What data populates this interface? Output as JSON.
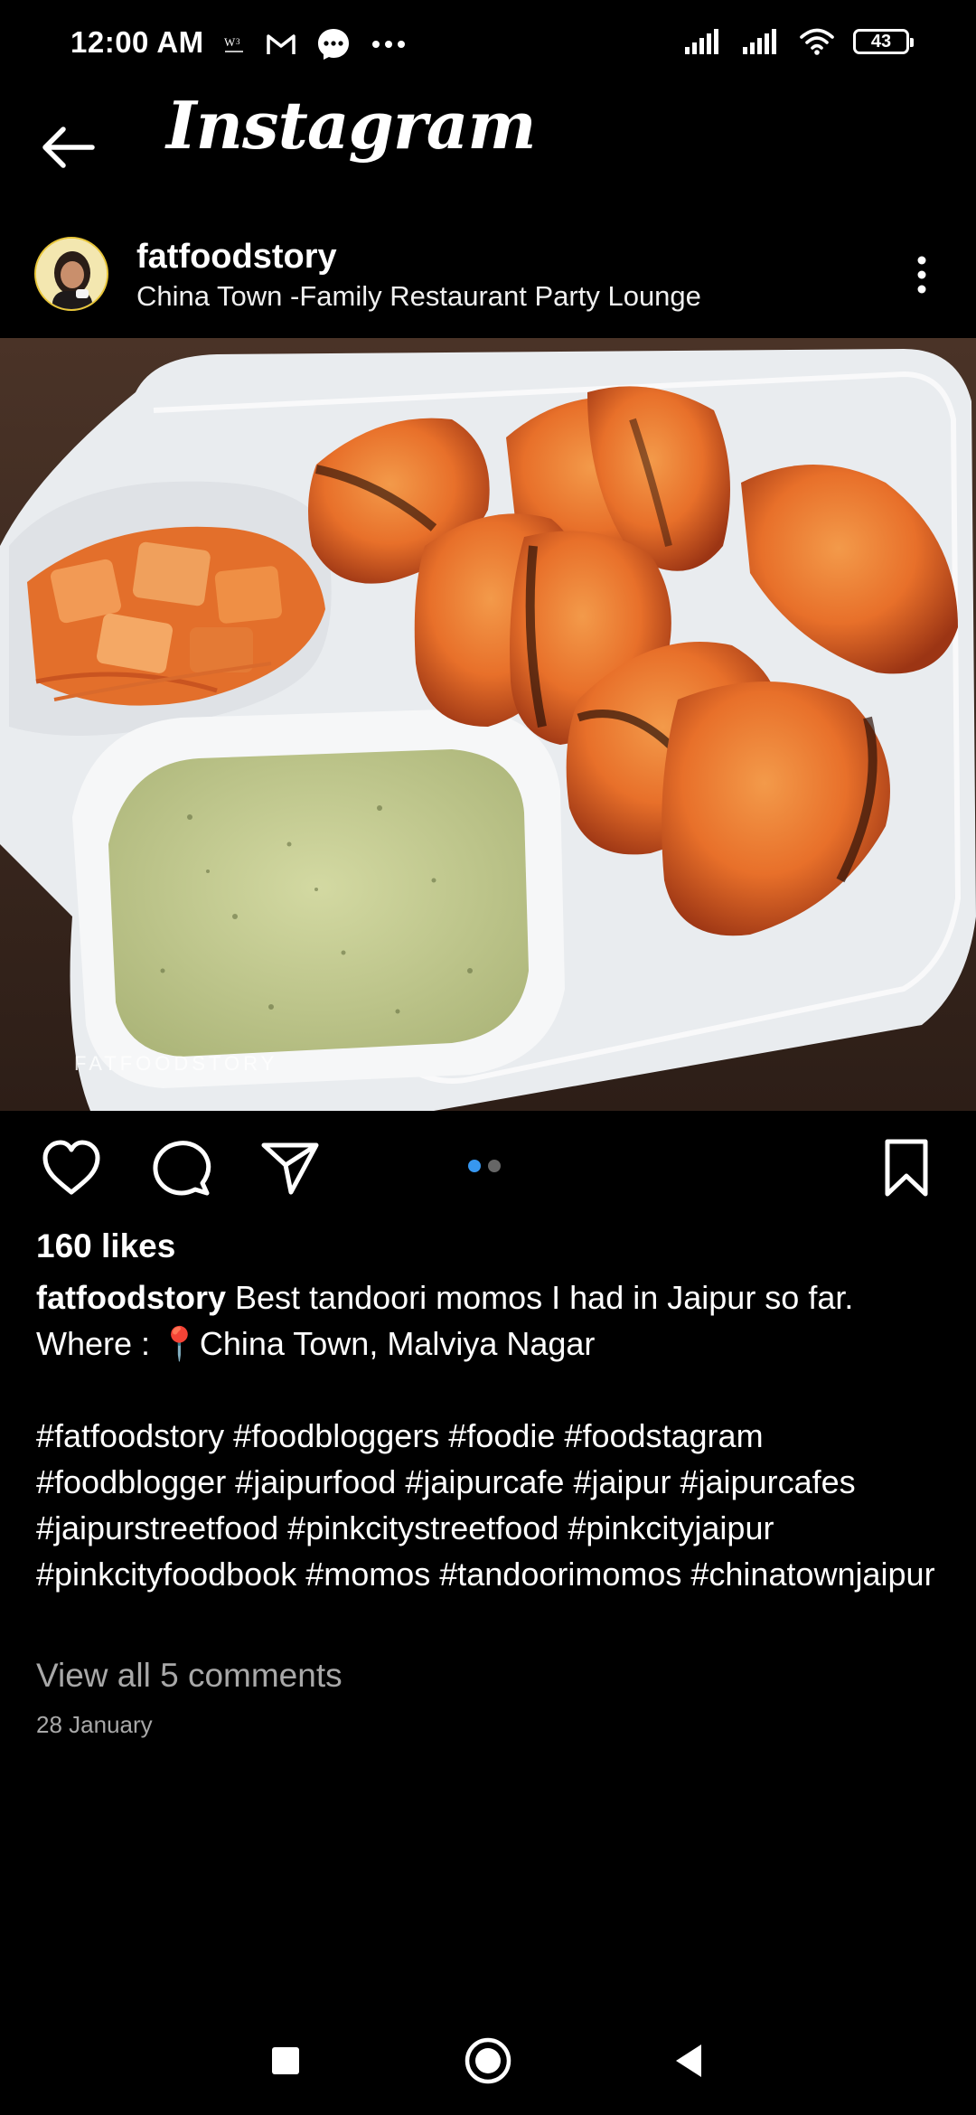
{
  "status_bar": {
    "time": "12:00 AM",
    "notification_icons": [
      "wo-icon",
      "gmail-icon",
      "messenger-icon",
      "more-dots-icon"
    ],
    "battery": "43",
    "icons": [
      "signal-icon",
      "signal-icon",
      "wifi-icon",
      "battery-icon"
    ]
  },
  "app_bar": {
    "title": "Instagram"
  },
  "post": {
    "username": "fatfoodstory",
    "location": "China Town -Family Restaurant Party Lounge",
    "watermark": "FATFOODSTORY",
    "carousel": {
      "count": 2,
      "active_index": 0
    },
    "likes": "160 likes",
    "caption_user": "fatfoodstory",
    "caption_text": " Best tandoori momos I had in Jaipur so far.",
    "caption_where": "Where : 📍China Town, Malviya Nagar",
    "hashtags": "#fatfoodstory #foodbloggers #foodie #foodstagram #foodblogger #jaipurfood #jaipurcafe #jaipur #jaipurcafes #jaipurstreetfood #pinkcitystreetfood #pinkcityjaipur #pinkcityfoodbook #momos #tandoorimomos #chinatownjaipur",
    "view_comments": "View all 5 comments",
    "date": "28 January"
  },
  "colors": {
    "background": "#000000",
    "accent": "#3797f0",
    "muted_text": "#a8a8a8"
  }
}
